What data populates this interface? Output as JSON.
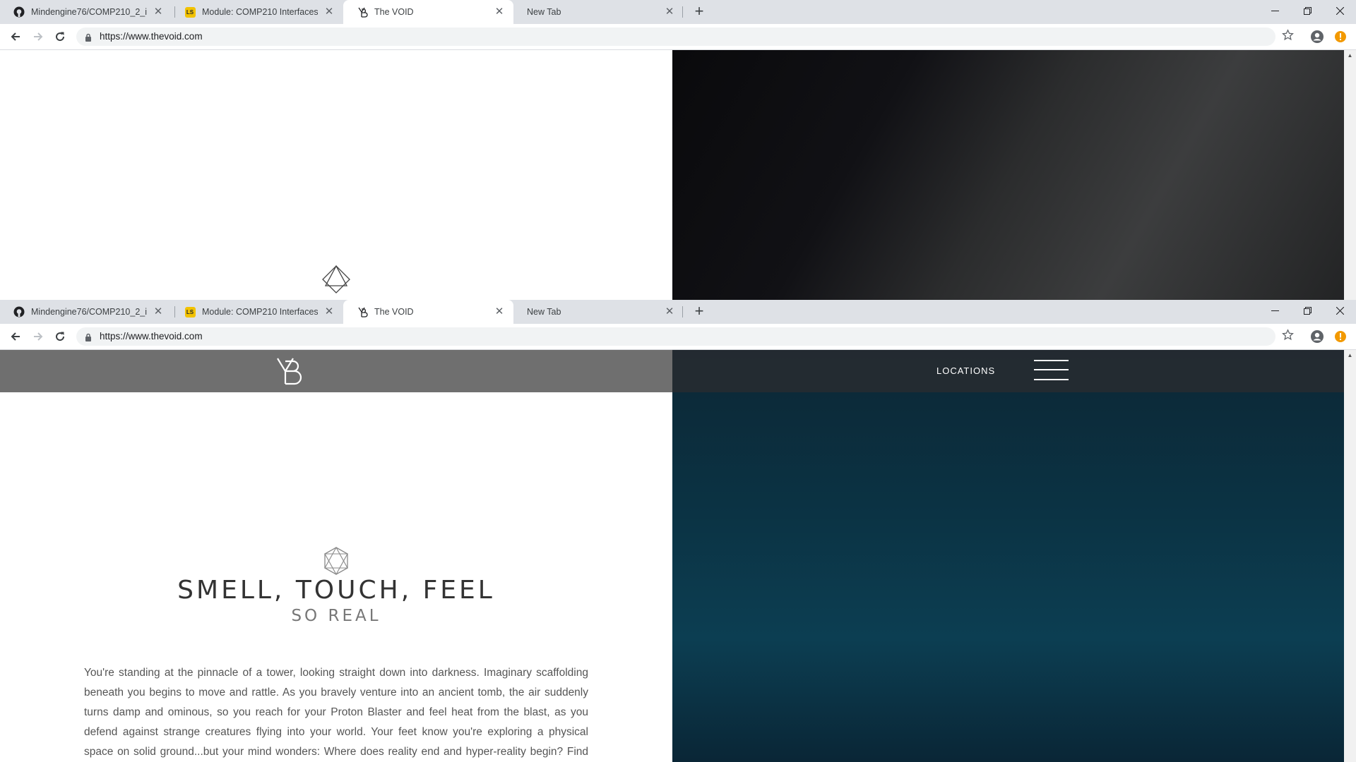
{
  "browser": {
    "tabs": [
      {
        "title": "Mindengine76/COMP210_2_interfaces",
        "favicon": "github-icon",
        "active": false
      },
      {
        "title": "Module: COMP210 Interfaces & Interaction",
        "favicon": "learning-space-icon",
        "favicon_text": "LS",
        "active": false
      },
      {
        "title": "The VOID",
        "favicon": "void-logo-icon",
        "active": true
      },
      {
        "title": "New Tab",
        "favicon": "",
        "active": false
      }
    ],
    "url": "https://www.thevoid.com",
    "colors": {
      "tabstrip": "#dee1e6",
      "omnibox": "#f1f3f4",
      "update_badge": "#f29900"
    }
  },
  "site": {
    "nav": {
      "locations_label": "LOCATIONS"
    },
    "headline": "SMELL, TOUCH, FEEL",
    "subheadline": "SO REAL",
    "body": "You're standing at the pinnacle of a tower, looking straight down into darkness. Imaginary scaffolding beneath you begins to move and rattle. As you bravely venture into an ancient tomb, the air suddenly turns damp and ominous, so you reach for your Proton Blaster and feel heat from the blast, as you defend against strange creatures flying into your world. Your feet know you're exploring a physical space on solid ground...but your mind wonders: Where does reality end and hyper-reality begin? Find out in THE VOID.",
    "colors": {
      "nav_left": "#6f6f6f",
      "headline": "#333333",
      "subheadline": "#777777",
      "body": "#555555"
    }
  }
}
